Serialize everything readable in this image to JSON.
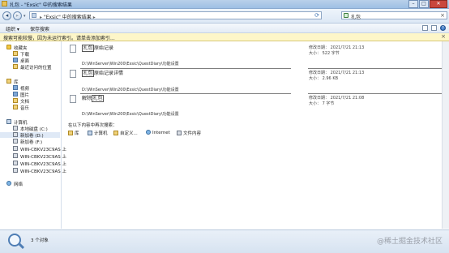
{
  "window": {
    "title": "扎包 - \"Exsic\" 中的搜索结果"
  },
  "address": {
    "crumb": "\"Exsic\" 中的搜索结果",
    "separator": "▸"
  },
  "search": {
    "value": "扎包"
  },
  "toolbar": {
    "organize": "组织 ▾",
    "save_search": "保存搜索"
  },
  "infobar": {
    "text": "搜索可能较慢，因为未运行索引。请单击添加索引..."
  },
  "sidebar": {
    "favorites": "收藏夹",
    "fav_items": [
      "下载",
      "桌面",
      "最近访问的位置"
    ],
    "libraries": "库",
    "lib_items": [
      "视频",
      "图片",
      "文档",
      "音乐"
    ],
    "computer": "计算机",
    "comp_items": [
      "本地磁盘 (C:)",
      "新加卷 (D:)",
      "新加卷 (F:)",
      "WIN-CBKV23C9AS 上",
      "WIN-CBKV23C9AS 上",
      "WIN-CBKV23C9AS 上",
      "WIN-CBKV23C9AS 上"
    ],
    "network": "网络"
  },
  "results": [
    {
      "name_hl": "扎包",
      "name_rest": "原始记录",
      "path": "D:\\WinServer\\Win200\\Exsic\\QuestDiary\\功能设置",
      "date_label": "修改日期：",
      "date": "2021/7/21 21:13",
      "size_label": "大小：",
      "size": "522 字节"
    },
    {
      "name_hl": "扎包",
      "name_rest": "原始记录详情",
      "path": "D:\\WinServer\\Win200\\Exsic\\QuestDiary\\功能设置",
      "date_label": "修改日期：",
      "date": "2021/7/21 21:13",
      "size_label": "大小：",
      "size": "2.96 KB"
    },
    {
      "name_pre": "解除",
      "name_hl": "扎包",
      "name_rest": "",
      "path": "D:\\WinServer\\Win200\\Exsic\\QuestDiary\\功能设置",
      "date_label": "修改日期：",
      "date": "2021/7/21 21:08",
      "size_label": "大小：",
      "size": "7 字节"
    }
  ],
  "search_again": {
    "label": "在以下内容中再次搜索：",
    "items": [
      "库",
      "计算机",
      "自定义...",
      "Internet",
      "文件内容"
    ]
  },
  "status": {
    "count": "3 个对象"
  },
  "watermark": "@稀土掘金技术社区"
}
